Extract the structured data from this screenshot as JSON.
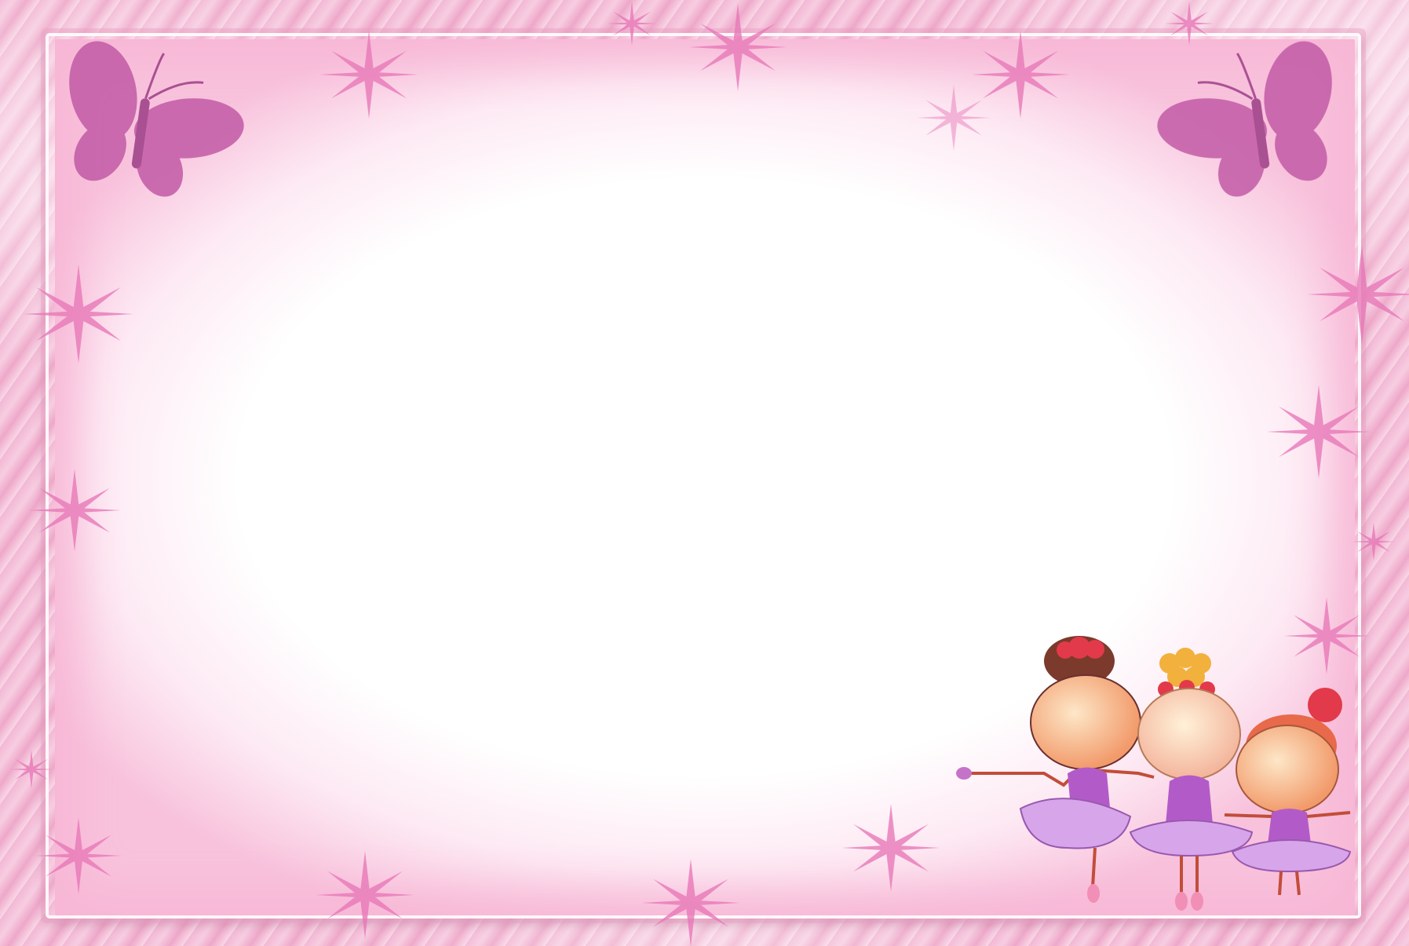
{
  "theme": {
    "frame_color": "#f3bcd6",
    "card_center_color": "#ffffff",
    "card_edge_color": "#f7b6d5",
    "sparkle_color": "#e878b8",
    "butterfly_color": "#c25aa6",
    "tutu_color": "#b25bc8"
  },
  "decorations": {
    "top_left": "butterfly-icon",
    "top_right": "butterfly-icon",
    "bottom_right": "ballerinas-illustration",
    "scattered": "sparkle-icon"
  }
}
